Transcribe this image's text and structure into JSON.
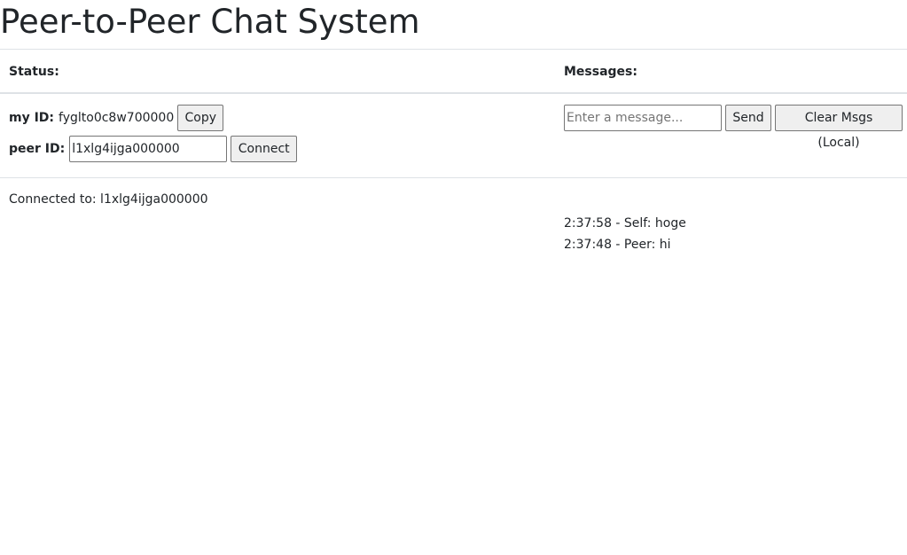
{
  "page": {
    "title": "Peer-to-Peer Chat System"
  },
  "table": {
    "status_header": "Status:",
    "messages_header": "Messages:"
  },
  "status": {
    "my_id_label": "my ID:",
    "my_id_value": "fyglto0c8w700000",
    "copy_button": "Copy",
    "peer_id_label": "peer ID:",
    "peer_id_value": "l1xlg4ijga000000",
    "connect_button": "Connect",
    "connection_text": "Connected to: l1xlg4ijga000000"
  },
  "messages": {
    "input_placeholder": "Enter a message...",
    "input_value": "",
    "send_button": "Send",
    "clear_button": "Clear Msgs (Local)",
    "items": [
      "2:37:58 - Self: hoge",
      "2:37:48 - Peer: hi"
    ]
  },
  "colors": {
    "text": "#212529",
    "divider": "#dee2e6",
    "button_bg": "#efefef"
  }
}
